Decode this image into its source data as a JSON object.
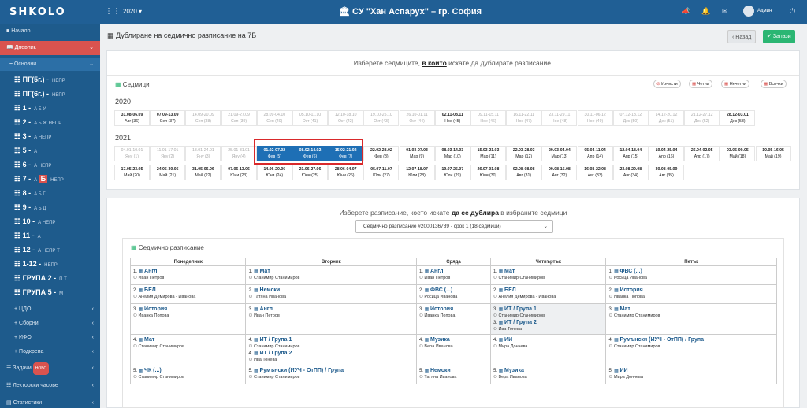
{
  "header": {
    "logo": "SHKOLO",
    "year": "2020",
    "school": "СУ \"Хан Аспарух\" – гр. София",
    "user": "Админ"
  },
  "sidebar": {
    "home": "Начало",
    "diary": "Дневник",
    "main": "Основни",
    "classes": [
      {
        "name": "ПГ(5г.) -",
        "small": "НЕПР"
      },
      {
        "name": "ПГ(6г.) -",
        "small": "НЕПР"
      },
      {
        "name": "1 -",
        "small": "А Б У"
      },
      {
        "name": "2 -",
        "small": "А Б Ж НЕПР"
      },
      {
        "name": "3 -",
        "small": "А НЕПР"
      },
      {
        "name": "5 -",
        "small": "А"
      },
      {
        "name": "6 -",
        "small": "А НЕПР"
      },
      {
        "name": "7 -",
        "small_pre": "А",
        "badge": "Б",
        "small": "НЕПР"
      },
      {
        "name": "8 -",
        "small": "А Б Г"
      },
      {
        "name": "9 -",
        "small": "А Б Д"
      },
      {
        "name": "10 -",
        "small": "А НЕПР"
      },
      {
        "name": "11 -",
        "small": "А"
      },
      {
        "name": "12 -",
        "small": "А НЕПР Т"
      },
      {
        "name": "1-12 -",
        "small": "НЕПР"
      },
      {
        "name": "ГРУПА 2 -",
        "small": "П Т"
      },
      {
        "name": "ГРУПА 5 -",
        "small": "М"
      }
    ],
    "groups": [
      "ЦДО",
      "Сборни",
      "ИФО",
      "Подкрепа"
    ],
    "tasks": "Задачи",
    "new_badge": "НОВО",
    "lecturer": "Лекторски часове",
    "stats": "Статистики"
  },
  "page": {
    "title": "Дублиране на седмично разписание на 7Б",
    "back": "Назад",
    "save": "Запази"
  },
  "weeks_panel": {
    "heading_pre": "Изберете седмиците, ",
    "heading_bold": "в които",
    "heading_post": " искате да дублирате разписание.",
    "section": "Седмици",
    "tools": [
      "Изчисти",
      "Четни",
      "Нечетни",
      "Всички"
    ],
    "year1": "2020",
    "year2": "2021",
    "row2020": [
      {
        "d": "31.08-06.09",
        "w": "Авг (36)",
        "s": "dark"
      },
      {
        "d": "07.09-13.09",
        "w": "Сеп (37)",
        "s": "dark"
      },
      {
        "d": "14.09-20.09",
        "w": "Сеп (38)",
        "s": "gray"
      },
      {
        "d": "21.09-27.09",
        "w": "Сеп (39)",
        "s": "gray"
      },
      {
        "d": "28.09-04.10",
        "w": "Сеп (40)",
        "s": "gray"
      },
      {
        "d": "05.10-11.10",
        "w": "Окт (41)",
        "s": "gray"
      },
      {
        "d": "12.10-18.10",
        "w": "Окт (42)",
        "s": "gray"
      },
      {
        "d": "19.10-25.10",
        "w": "Окт (43)",
        "s": "gray"
      },
      {
        "d": "26.10-01.11",
        "w": "Окт (44)",
        "s": "gray"
      },
      {
        "d": "02.11-08.11",
        "w": "Ное (45)",
        "s": "dark"
      },
      {
        "d": "09.11-15.11",
        "w": "Ное (46)",
        "s": "gray"
      },
      {
        "d": "16.11-22.11",
        "w": "Ное (47)",
        "s": "gray"
      },
      {
        "d": "23.11-29.11",
        "w": "Ное (48)",
        "s": "gray"
      },
      {
        "d": "30.11-06.12",
        "w": "Ное (49)",
        "s": "gray"
      },
      {
        "d": "07.12-13.12",
        "w": "Дек (50)",
        "s": "gray"
      },
      {
        "d": "14.12-20.12",
        "w": "Дек (51)",
        "s": "gray"
      },
      {
        "d": "21.12-27.12",
        "w": "Дек (52)",
        "s": "gray"
      },
      {
        "d": "28.12-03.01",
        "w": "Дек (53)",
        "s": "dark"
      }
    ],
    "row2021a": [
      {
        "d": "04.01-10.01",
        "w": "Яну (1)",
        "s": "gray"
      },
      {
        "d": "11.01-17.01",
        "w": "Яну (2)",
        "s": "gray"
      },
      {
        "d": "18.01-24.01",
        "w": "Яну (3)",
        "s": "gray"
      },
      {
        "d": "25.01-31.01",
        "w": "Яну (4)",
        "s": "gray"
      },
      {
        "d": "01.02-07.02",
        "w": "Фев (5)",
        "s": "sel"
      },
      {
        "d": "08.02-14.02",
        "w": "Фев (6)",
        "s": "sel"
      },
      {
        "d": "15.02-21.02",
        "w": "Фев (7)",
        "s": "sel"
      },
      {
        "d": "22.02-28.02",
        "w": "Фев (8)",
        "s": "dark"
      },
      {
        "d": "01.03-07.03",
        "w": "Мар (9)",
        "s": "dark"
      },
      {
        "d": "08.03-14.03",
        "w": "Мар (10)",
        "s": "dark"
      },
      {
        "d": "15.03-21.03",
        "w": "Мар (11)",
        "s": "dark"
      },
      {
        "d": "22.03-28.03",
        "w": "Мар (12)",
        "s": "dark"
      },
      {
        "d": "29.03-04.04",
        "w": "Мар (13)",
        "s": "dark"
      },
      {
        "d": "05.04-11.04",
        "w": "Апр (14)",
        "s": "dark"
      },
      {
        "d": "12.04-18.04",
        "w": "Апр (15)",
        "s": "dark"
      },
      {
        "d": "19.04-25.04",
        "w": "Апр (16)",
        "s": "dark"
      },
      {
        "d": "26.04-02.05",
        "w": "Апр (17)",
        "s": "dark"
      },
      {
        "d": "03.05-09.05",
        "w": "Май (18)",
        "s": "dark"
      },
      {
        "d": "10.05-16.05",
        "w": "Май (19)",
        "s": "dark"
      }
    ],
    "row2021b": [
      {
        "d": "17.05-23.05",
        "w": "Май (20)",
        "s": "dark"
      },
      {
        "d": "24.05-30.05",
        "w": "Май (21)",
        "s": "dark"
      },
      {
        "d": "31.05-06.06",
        "w": "Май (22)",
        "s": "dark"
      },
      {
        "d": "07.06-13.06",
        "w": "Юни (23)",
        "s": "dark"
      },
      {
        "d": "14.06-20.06",
        "w": "Юни (24)",
        "s": "dark"
      },
      {
        "d": "21.06-27.06",
        "w": "Юни (25)",
        "s": "dark"
      },
      {
        "d": "28.06-04.07",
        "w": "Юни (26)",
        "s": "dark"
      },
      {
        "d": "05.07-11.07",
        "w": "Юли (27)",
        "s": "dark"
      },
      {
        "d": "12.07-18.07",
        "w": "Юли (28)",
        "s": "dark"
      },
      {
        "d": "19.07-25.07",
        "w": "Юли (29)",
        "s": "dark"
      },
      {
        "d": "26.07-01.08",
        "w": "Юли (30)",
        "s": "dark"
      },
      {
        "d": "02.08-08.08",
        "w": "Авг (31)",
        "s": "dark"
      },
      {
        "d": "09.08-15.08",
        "w": "Авг (32)",
        "s": "dark"
      },
      {
        "d": "16.08-22.08",
        "w": "Авг (33)",
        "s": "dark"
      },
      {
        "d": "23.08-29.08",
        "w": "Авг (34)",
        "s": "dark"
      },
      {
        "d": "30.08-05.09",
        "w": "Авг (35)",
        "s": "dark"
      }
    ]
  },
  "schedule_panel": {
    "heading_pre": "Изберете разписание, което искате ",
    "heading_bold": "да се дублира",
    "heading_post": " в избраните седмици",
    "select_value": "Седмично разписание #2000136789 - срок 1 (18 седмици)",
    "section": "Седмично разписание",
    "days": [
      "Понеделник",
      "Вторник",
      "Сряда",
      "Четвъртък",
      "Петък"
    ],
    "rows": [
      [
        [
          {
            "n": "1.",
            "s": "Англ",
            "t": "Иван Петров"
          }
        ],
        [
          {
            "n": "1.",
            "s": "Мат",
            "t": "Станимир Станимиров"
          }
        ],
        [
          {
            "n": "1.",
            "s": "Англ",
            "t": "Иван Петров"
          }
        ],
        [
          {
            "n": "1.",
            "s": "Мат",
            "t": "Станимир Станимиров"
          }
        ],
        [
          {
            "n": "1.",
            "s": "ФВС (...)",
            "t": "Росица Иванова"
          }
        ]
      ],
      [
        [
          {
            "n": "2.",
            "s": "БЕЛ",
            "t": "Анелия Демирова - Иванова"
          }
        ],
        [
          {
            "n": "2.",
            "s": "Немски",
            "t": "Татяна Иванова"
          }
        ],
        [
          {
            "n": "2.",
            "s": "ФВС (...)",
            "t": "Росица Иванова"
          }
        ],
        [
          {
            "n": "2.",
            "s": "БЕЛ",
            "t": "Анелия Демирова - Иванова"
          }
        ],
        [
          {
            "n": "2.",
            "s": "История",
            "t": "Иванка Попова"
          }
        ]
      ],
      [
        [
          {
            "n": "3.",
            "s": "История",
            "t": "Иванка Попова"
          }
        ],
        [
          {
            "n": "3.",
            "s": "Англ",
            "t": "Иван Петров"
          }
        ],
        [
          {
            "n": "3.",
            "s": "История",
            "t": "Иванка Попова"
          }
        ],
        [
          {
            "n": "3.",
            "s": "ИТ / Група 1",
            "t": "Станимир Станимиров"
          },
          {
            "n": "3.",
            "s": "ИТ / Група 2",
            "t": "Ива Тонева"
          }
        ],
        [
          {
            "n": "3.",
            "s": "Мат",
            "t": "Станимир Станимиров"
          }
        ]
      ],
      [
        [
          {
            "n": "4.",
            "s": "Мат",
            "t": "Станимир Станимиров"
          }
        ],
        [
          {
            "n": "4.",
            "s": "ИТ / Група 1",
            "t": "Станимир Станимиров"
          },
          {
            "n": "4.",
            "s": "ИТ / Група 2",
            "t": "Ива Тонева"
          }
        ],
        [
          {
            "n": "4.",
            "s": "Музика",
            "t": "Вера Иванова"
          }
        ],
        [
          {
            "n": "4.",
            "s": "ИИ",
            "t": "Мира Дончева"
          }
        ],
        [
          {
            "n": "4.",
            "s": "Румънски (ИУЧ - ОтПП) / Група",
            "t": "Станимир Станимиров"
          }
        ]
      ],
      [
        [
          {
            "n": "5.",
            "s": "ЧК (...)",
            "t": "Станимир Станимиров"
          }
        ],
        [
          {
            "n": "5.",
            "s": "Румънски (ИУЧ - ОтПП) / Група",
            "t": "Станимир Станимиров"
          }
        ],
        [
          {
            "n": "5.",
            "s": "Немски",
            "t": "Татяна Иванова"
          }
        ],
        [
          {
            "n": "5.",
            "s": "Музика",
            "t": "Вера Иванова"
          }
        ],
        [
          {
            "n": "5.",
            "s": "ИИ",
            "t": "Мира Дончева"
          }
        ]
      ]
    ]
  }
}
